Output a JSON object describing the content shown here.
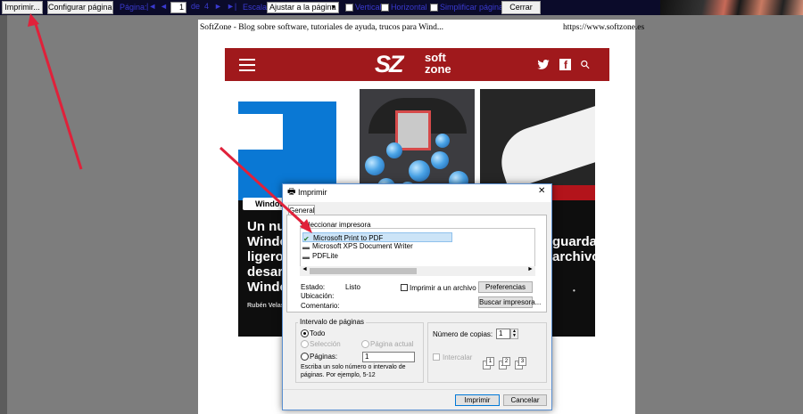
{
  "toolbar": {
    "print_button": "Imprimir...",
    "page_setup_button": "Configurar página...",
    "page_label": "Página:",
    "first_glyph": "|◄",
    "prev_glyph": "◄",
    "page_value": "1",
    "page_of": "de",
    "page_total": "4",
    "next_glyph": "►",
    "last_glyph": "►|",
    "scale_label": "Escala:",
    "scale_value": "Ajustar a la página",
    "vertical_label": "Vertical",
    "horizontal_label": "Horizontal",
    "simplify_label": "Simplificar página",
    "close_button": "Cerrar"
  },
  "page": {
    "header_left": "SoftZone - Blog sobre software, tutoriales de ayuda, trucos para Wind...",
    "header_right": "https://www.softzone.es",
    "logo_mark": "SZ",
    "logo_soft": "soft",
    "logo_zone": "zone",
    "twitter_icon": "twitter-bird",
    "facebook_icon": "f",
    "search_icon": "⚲",
    "tag_left": "Window",
    "left_lines": [
      "Un nue",
      "Windo",
      "ligero d",
      "desarr",
      "Windo"
    ],
    "left_author": "Rubén Velas",
    "right_lines": [
      "guarda",
      "archivo"
    ],
    "right_dot": "•"
  },
  "dialog": {
    "title": "Imprimir",
    "close_glyph": "✕",
    "tab_general": "General",
    "select_printer_label": "Seleccionar impresora",
    "printers": [
      "Microsoft Print to PDF",
      "Microsoft XPS Document Writer",
      "PDFLite"
    ],
    "status_label": "Estado:",
    "status_value": "Listo",
    "location_label": "Ubicación:",
    "comment_label": "Comentario:",
    "print_to_file_label": "Imprimir a un archivo",
    "preferences_button": "Preferencias",
    "find_printer_button": "Buscar impresora...",
    "page_range_label": "Intervalo de páginas",
    "all_label": "Todo",
    "selection_label": "Selección",
    "current_page_label": "Página actual",
    "pages_label": "Páginas:",
    "pages_value": "1",
    "hint_line1": "Escriba un solo número o intervalo de",
    "hint_line2": "páginas. Por ejemplo, 5-12",
    "copies_label": "Número de copias:",
    "copies_value": "1",
    "collate_label": "Intercalar",
    "print_button": "Imprimir",
    "cancel_button": "Cancelar"
  },
  "colors": {
    "banner": "#a0191c",
    "toolbar": "#0b0b2a",
    "accent_link": "#3a3ad0",
    "arrow": "#e0213a"
  }
}
